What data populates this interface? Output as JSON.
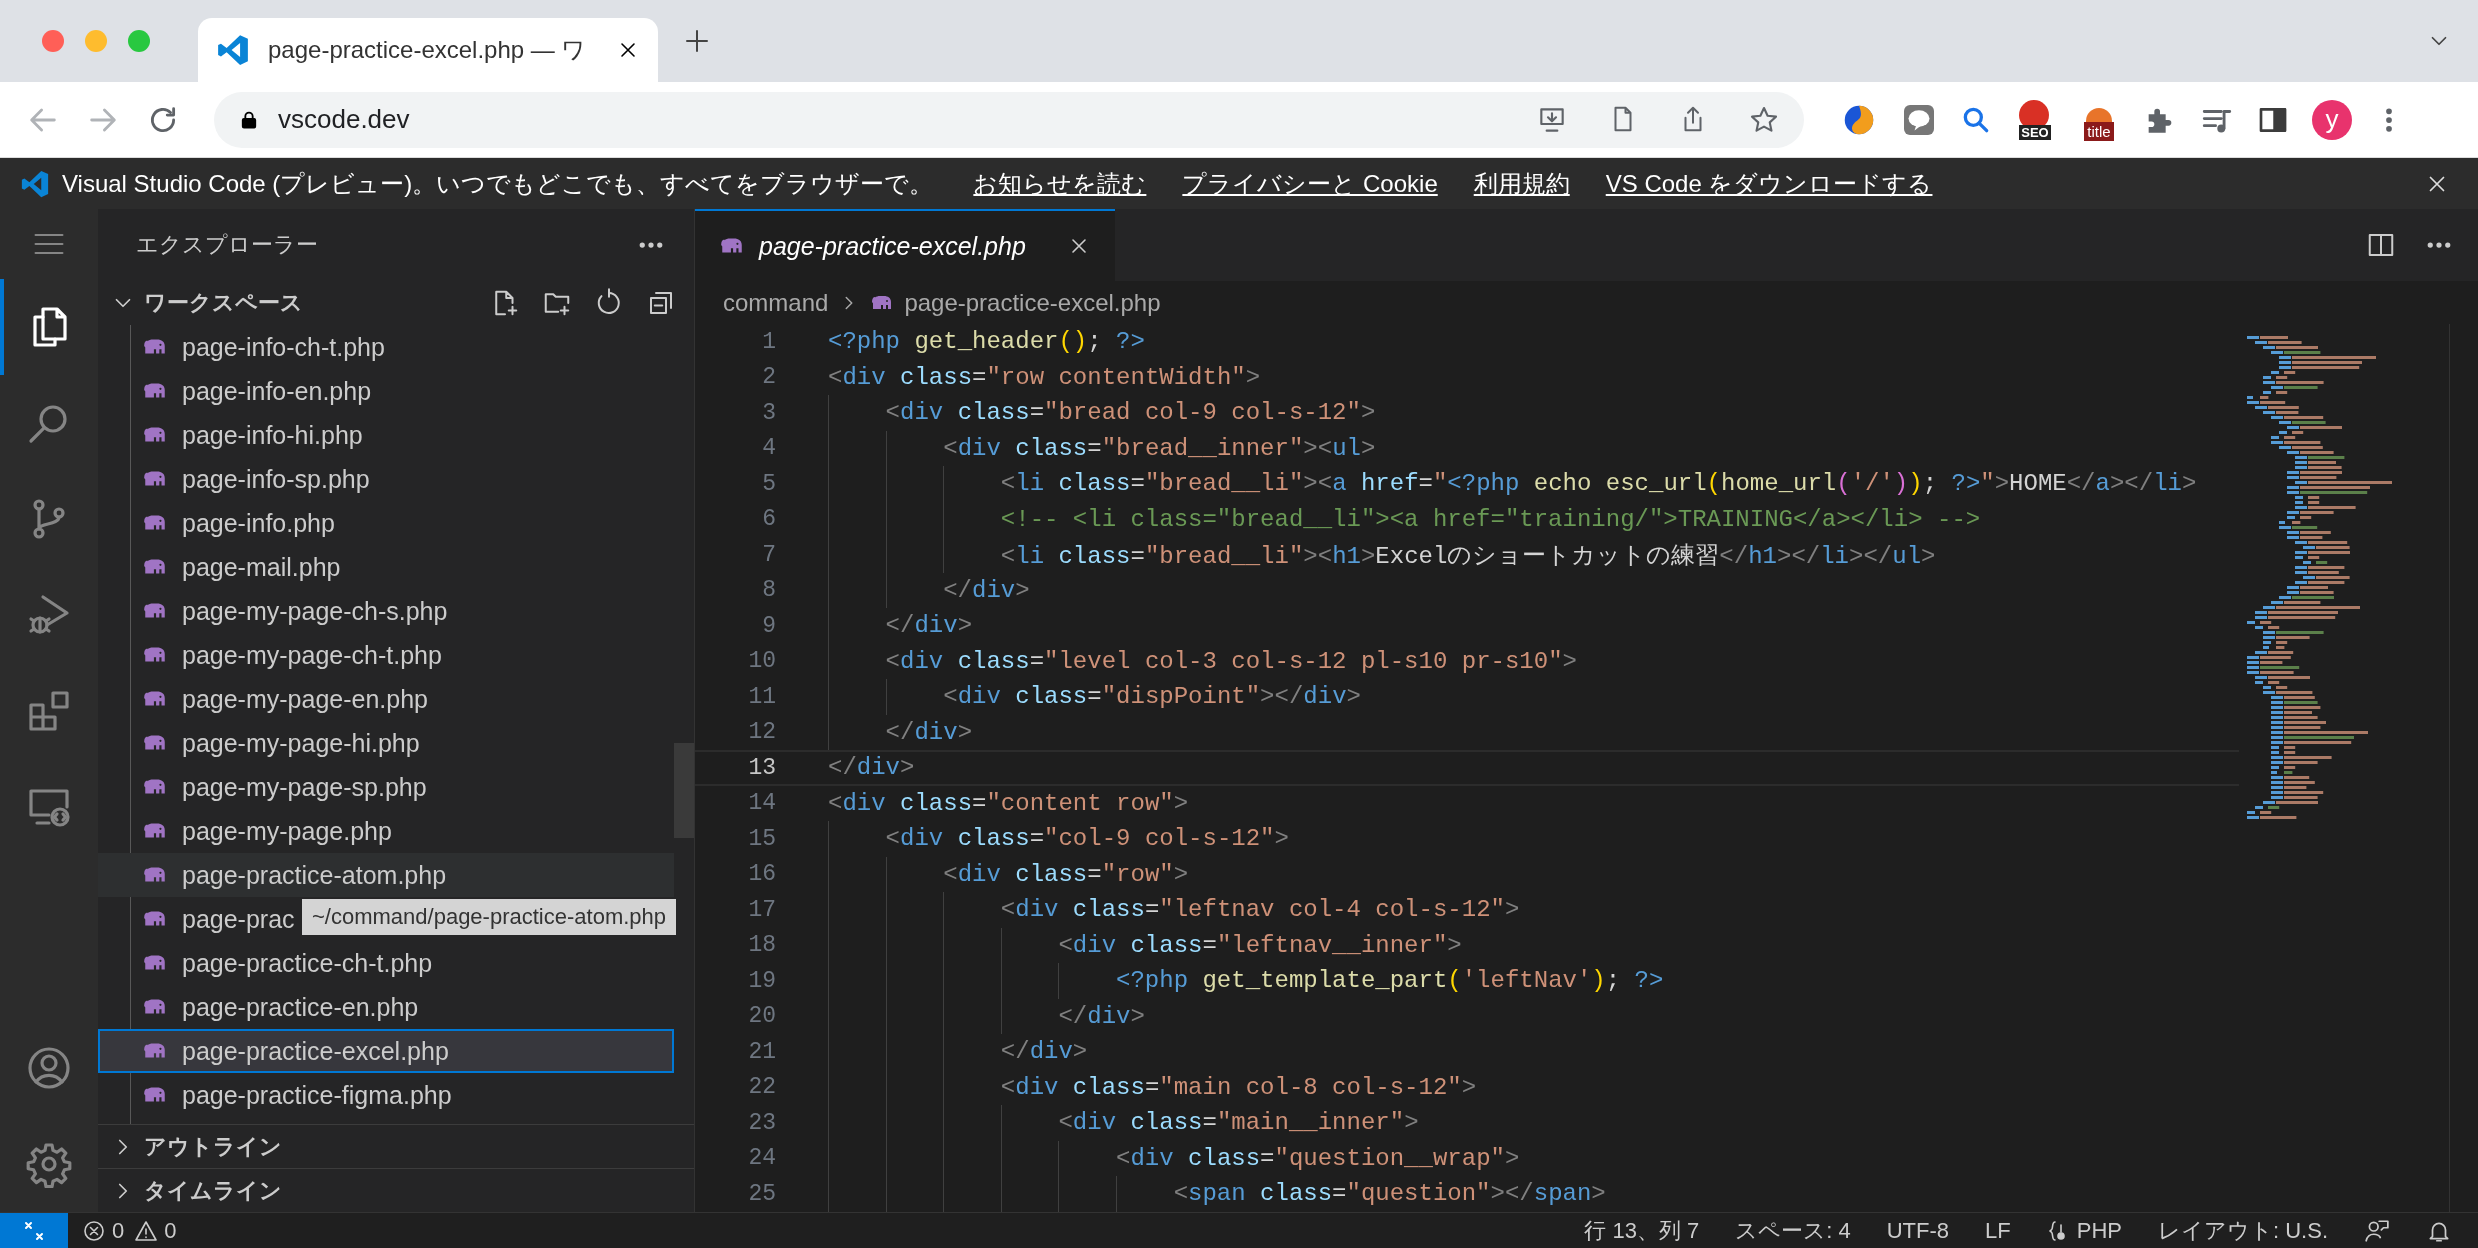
{
  "browser": {
    "tab": {
      "title": "page-practice-excel.php — ワ"
    },
    "address": "vscode.dev",
    "extensions": [
      {
        "kind": "swirl"
      },
      {
        "kind": "chat"
      },
      {
        "kind": "search"
      },
      {
        "kind": "seo",
        "label": "SEO"
      },
      {
        "kind": "title",
        "label": "title"
      },
      {
        "kind": "puzzle"
      },
      {
        "kind": "playlist"
      },
      {
        "kind": "sidepanel"
      }
    ],
    "avatar": "y"
  },
  "banner": {
    "text": "Visual Studio Code (プレビュー)。いつでもどこでも、すべてをブラウザーで。",
    "links": [
      "お知らせを読む",
      "プライバシーと Cookie",
      "利用規約",
      "VS Code をダウンロードする"
    ]
  },
  "activity_bar": [
    {
      "selected": true
    },
    {
      "selected": false
    },
    {
      "selected": false
    },
    {
      "selected": false
    },
    {
      "selected": false
    },
    {
      "selected": false
    }
  ],
  "sidebar": {
    "title": "エクスプローラー",
    "sections": [
      {
        "title": "ワークスペース",
        "expanded": true,
        "files": [
          {
            "name": "page-info-ch-t.php",
            "selected": false,
            "hovered": false
          },
          {
            "name": "page-info-en.php",
            "selected": false,
            "hovered": false
          },
          {
            "name": "page-info-hi.php",
            "selected": false,
            "hovered": false
          },
          {
            "name": "page-info-sp.php",
            "selected": false,
            "hovered": false
          },
          {
            "name": "page-info.php",
            "selected": false,
            "hovered": false
          },
          {
            "name": "page-mail.php",
            "selected": false,
            "hovered": false
          },
          {
            "name": "page-my-page-ch-s.php",
            "selected": false,
            "hovered": false
          },
          {
            "name": "page-my-page-ch-t.php",
            "selected": false,
            "hovered": false
          },
          {
            "name": "page-my-page-en.php",
            "selected": false,
            "hovered": false
          },
          {
            "name": "page-my-page-hi.php",
            "selected": false,
            "hovered": false
          },
          {
            "name": "page-my-page-sp.php",
            "selected": false,
            "hovered": false
          },
          {
            "name": "page-my-page.php",
            "selected": false,
            "hovered": false
          },
          {
            "name": "page-practice-atom.php",
            "selected": false,
            "hovered": true,
            "tooltip": "~/command/page-practice-atom.php"
          },
          {
            "name": "page-prac",
            "selected": false,
            "hovered": false
          },
          {
            "name": "page-practice-ch-t.php",
            "selected": false,
            "hovered": false
          },
          {
            "name": "page-practice-en.php",
            "selected": false,
            "hovered": false
          },
          {
            "name": "page-practice-excel.php",
            "selected": true,
            "hovered": false
          },
          {
            "name": "page-practice-figma.php",
            "selected": false,
            "hovered": false
          }
        ]
      },
      {
        "title": "アウトライン",
        "expanded": false
      },
      {
        "title": "タイムライン",
        "expanded": false
      }
    ]
  },
  "editor": {
    "tabs": [
      {
        "title": "page-practice-excel.php",
        "selected": true,
        "preview": true
      }
    ],
    "breadcrumb": [
      "command",
      "page-practice-excel.php"
    ],
    "lines": [
      {
        "number": "1",
        "current": false,
        "segments": [
          {
            "kind": "tag",
            "text": "<?php"
          },
          {
            "kind": "func",
            "text": " get_header"
          },
          {
            "kind": "bracket",
            "text": "()"
          },
          {
            "kind": "text",
            "text": "; "
          },
          {
            "kind": "tag",
            "text": "?>"
          }
        ]
      },
      {
        "number": "2",
        "current": false,
        "segments": [
          {
            "kind": "punct",
            "text": "<"
          },
          {
            "kind": "tag",
            "text": "div"
          },
          {
            "kind": "attr",
            "text": " class"
          },
          {
            "kind": "text",
            "text": "="
          },
          {
            "kind": "string",
            "text": "\"row contentWidth\""
          },
          {
            "kind": "punct",
            "text": ">"
          }
        ]
      },
      {
        "number": "3",
        "current": false,
        "segments": [
          {
            "kind": "punct",
            "text": "    <"
          },
          {
            "kind": "tag",
            "text": "div"
          },
          {
            "kind": "attr",
            "text": " class"
          },
          {
            "kind": "text",
            "text": "="
          },
          {
            "kind": "string",
            "text": "\"bread col-9 col-s-12\""
          },
          {
            "kind": "punct",
            "text": ">"
          }
        ]
      },
      {
        "number": "4",
        "current": false,
        "segments": [
          {
            "kind": "punct",
            "text": "        <"
          },
          {
            "kind": "tag",
            "text": "div"
          },
          {
            "kind": "attr",
            "text": " class"
          },
          {
            "kind": "text",
            "text": "="
          },
          {
            "kind": "string",
            "text": "\"bread__inner\""
          },
          {
            "kind": "punct",
            "text": "><"
          },
          {
            "kind": "tag",
            "text": "ul"
          },
          {
            "kind": "punct",
            "text": ">"
          }
        ]
      },
      {
        "number": "5",
        "current": false,
        "segments": [
          {
            "kind": "punct",
            "text": "            <"
          },
          {
            "kind": "tag",
            "text": "li"
          },
          {
            "kind": "attr",
            "text": " class"
          },
          {
            "kind": "text",
            "text": "="
          },
          {
            "kind": "string",
            "text": "\"bread__li\""
          },
          {
            "kind": "punct",
            "text": "><"
          },
          {
            "kind": "tag",
            "text": "a"
          },
          {
            "kind": "attr",
            "text": " href"
          },
          {
            "kind": "text",
            "text": "="
          },
          {
            "kind": "string",
            "text": "\""
          },
          {
            "kind": "tag",
            "text": "<?php"
          },
          {
            "kind": "func",
            "text": " echo esc_url"
          },
          {
            "kind": "bracket",
            "text": "("
          },
          {
            "kind": "func",
            "text": "home_url"
          },
          {
            "kind": "bracket2",
            "text": "("
          },
          {
            "kind": "string",
            "text": "'/'"
          },
          {
            "kind": "bracket2",
            "text": ")"
          },
          {
            "kind": "bracket",
            "text": ")"
          },
          {
            "kind": "text",
            "text": "; "
          },
          {
            "kind": "tag",
            "text": "?>"
          },
          {
            "kind": "string",
            "text": "\""
          },
          {
            "kind": "punct",
            "text": ">"
          },
          {
            "kind": "text",
            "text": "HOME"
          },
          {
            "kind": "punct",
            "text": "</"
          },
          {
            "kind": "tag",
            "text": "a"
          },
          {
            "kind": "punct",
            "text": "></"
          },
          {
            "kind": "tag",
            "text": "li"
          },
          {
            "kind": "punct",
            "text": ">"
          }
        ]
      },
      {
        "number": "6",
        "current": false,
        "segments": [
          {
            "kind": "comment",
            "text": "            <!-- <li class=\"bread__li\"><a href=\"training/\">TRAINING</a></li> -->"
          }
        ]
      },
      {
        "number": "7",
        "current": false,
        "segments": [
          {
            "kind": "punct",
            "text": "            <"
          },
          {
            "kind": "tag",
            "text": "li"
          },
          {
            "kind": "attr",
            "text": " class"
          },
          {
            "kind": "text",
            "text": "="
          },
          {
            "kind": "string",
            "text": "\"bread__li\""
          },
          {
            "kind": "punct",
            "text": "><"
          },
          {
            "kind": "tag",
            "text": "h1"
          },
          {
            "kind": "punct",
            "text": ">"
          },
          {
            "kind": "text",
            "text": "Excelのショートカットの練習"
          },
          {
            "kind": "punct",
            "text": "</"
          },
          {
            "kind": "tag",
            "text": "h1"
          },
          {
            "kind": "punct",
            "text": "></"
          },
          {
            "kind": "tag",
            "text": "li"
          },
          {
            "kind": "punct",
            "text": "></"
          },
          {
            "kind": "tag",
            "text": "ul"
          },
          {
            "kind": "punct",
            "text": ">"
          }
        ]
      },
      {
        "number": "8",
        "current": false,
        "segments": [
          {
            "kind": "punct",
            "text": "        </"
          },
          {
            "kind": "tag",
            "text": "div"
          },
          {
            "kind": "punct",
            "text": ">"
          }
        ]
      },
      {
        "number": "9",
        "current": false,
        "segments": [
          {
            "kind": "punct",
            "text": "    </"
          },
          {
            "kind": "tag",
            "text": "div"
          },
          {
            "kind": "punct",
            "text": ">"
          }
        ]
      },
      {
        "number": "10",
        "current": false,
        "segments": [
          {
            "kind": "punct",
            "text": "    <"
          },
          {
            "kind": "tag",
            "text": "div"
          },
          {
            "kind": "attr",
            "text": " class"
          },
          {
            "kind": "text",
            "text": "="
          },
          {
            "kind": "string",
            "text": "\"level col-3 col-s-12 pl-s10 pr-s10\""
          },
          {
            "kind": "punct",
            "text": ">"
          }
        ]
      },
      {
        "number": "11",
        "current": false,
        "segments": [
          {
            "kind": "punct",
            "text": "        <"
          },
          {
            "kind": "tag",
            "text": "div"
          },
          {
            "kind": "attr",
            "text": " class"
          },
          {
            "kind": "text",
            "text": "="
          },
          {
            "kind": "string",
            "text": "\"dispPoint\""
          },
          {
            "kind": "punct",
            "text": "></"
          },
          {
            "kind": "tag",
            "text": "div"
          },
          {
            "kind": "punct",
            "text": ">"
          }
        ]
      },
      {
        "number": "12",
        "current": false,
        "segments": [
          {
            "kind": "punct",
            "text": "    </"
          },
          {
            "kind": "tag",
            "text": "div"
          },
          {
            "kind": "punct",
            "text": ">"
          }
        ]
      },
      {
        "number": "13",
        "current": true,
        "segments": [
          {
            "kind": "punct",
            "text": "</"
          },
          {
            "kind": "tag",
            "text": "div"
          },
          {
            "kind": "punct",
            "text": ">"
          }
        ]
      },
      {
        "number": "14",
        "current": false,
        "segments": [
          {
            "kind": "punct",
            "text": "<"
          },
          {
            "kind": "tag",
            "text": "div"
          },
          {
            "kind": "attr",
            "text": " class"
          },
          {
            "kind": "text",
            "text": "="
          },
          {
            "kind": "string",
            "text": "\"content row\""
          },
          {
            "kind": "punct",
            "text": ">"
          }
        ]
      },
      {
        "number": "15",
        "current": false,
        "segments": [
          {
            "kind": "punct",
            "text": "    <"
          },
          {
            "kind": "tag",
            "text": "div"
          },
          {
            "kind": "attr",
            "text": " class"
          },
          {
            "kind": "text",
            "text": "="
          },
          {
            "kind": "string",
            "text": "\"col-9 col-s-12\""
          },
          {
            "kind": "punct",
            "text": ">"
          }
        ]
      },
      {
        "number": "16",
        "current": false,
        "segments": [
          {
            "kind": "punct",
            "text": "        <"
          },
          {
            "kind": "tag",
            "text": "div"
          },
          {
            "kind": "attr",
            "text": " class"
          },
          {
            "kind": "text",
            "text": "="
          },
          {
            "kind": "string",
            "text": "\"row\""
          },
          {
            "kind": "punct",
            "text": ">"
          }
        ]
      },
      {
        "number": "17",
        "current": false,
        "segments": [
          {
            "kind": "punct",
            "text": "            <"
          },
          {
            "kind": "tag",
            "text": "div"
          },
          {
            "kind": "attr",
            "text": " class"
          },
          {
            "kind": "text",
            "text": "="
          },
          {
            "kind": "string",
            "text": "\"leftnav col-4 col-s-12\""
          },
          {
            "kind": "punct",
            "text": ">"
          }
        ]
      },
      {
        "number": "18",
        "current": false,
        "segments": [
          {
            "kind": "punct",
            "text": "                <"
          },
          {
            "kind": "tag",
            "text": "div"
          },
          {
            "kind": "attr",
            "text": " class"
          },
          {
            "kind": "text",
            "text": "="
          },
          {
            "kind": "string",
            "text": "\"leftnav__inner\""
          },
          {
            "kind": "punct",
            "text": ">"
          }
        ]
      },
      {
        "number": "19",
        "current": false,
        "segments": [
          {
            "kind": "tag",
            "text": "                    <?php"
          },
          {
            "kind": "func",
            "text": " get_template_part"
          },
          {
            "kind": "bracket",
            "text": "("
          },
          {
            "kind": "string",
            "text": "'leftNav'"
          },
          {
            "kind": "bracket",
            "text": ")"
          },
          {
            "kind": "text",
            "text": "; "
          },
          {
            "kind": "tag",
            "text": "?>"
          }
        ]
      },
      {
        "number": "20",
        "current": false,
        "segments": [
          {
            "kind": "punct",
            "text": "                </"
          },
          {
            "kind": "tag",
            "text": "div"
          },
          {
            "kind": "punct",
            "text": ">"
          }
        ]
      },
      {
        "number": "21",
        "current": false,
        "segments": [
          {
            "kind": "punct",
            "text": "            </"
          },
          {
            "kind": "tag",
            "text": "div"
          },
          {
            "kind": "punct",
            "text": ">"
          }
        ]
      },
      {
        "number": "22",
        "current": false,
        "segments": [
          {
            "kind": "punct",
            "text": "            <"
          },
          {
            "kind": "tag",
            "text": "div"
          },
          {
            "kind": "attr",
            "text": " class"
          },
          {
            "kind": "text",
            "text": "="
          },
          {
            "kind": "string",
            "text": "\"main col-8 col-s-12\""
          },
          {
            "kind": "punct",
            "text": ">"
          }
        ]
      },
      {
        "number": "23",
        "current": false,
        "segments": [
          {
            "kind": "punct",
            "text": "                <"
          },
          {
            "kind": "tag",
            "text": "div"
          },
          {
            "kind": "attr",
            "text": " class"
          },
          {
            "kind": "text",
            "text": "="
          },
          {
            "kind": "string",
            "text": "\"main__inner\""
          },
          {
            "kind": "punct",
            "text": ">"
          }
        ]
      },
      {
        "number": "24",
        "current": false,
        "segments": [
          {
            "kind": "punct",
            "text": "                    <"
          },
          {
            "kind": "tag",
            "text": "div"
          },
          {
            "kind": "attr",
            "text": " class"
          },
          {
            "kind": "text",
            "text": "="
          },
          {
            "kind": "string",
            "text": "\"question__wrap\""
          },
          {
            "kind": "punct",
            "text": ">"
          }
        ]
      },
      {
        "number": "25",
        "current": false,
        "segments": [
          {
            "kind": "punct",
            "text": "                        <"
          },
          {
            "kind": "tag",
            "text": "span"
          },
          {
            "kind": "attr",
            "text": " class"
          },
          {
            "kind": "text",
            "text": "="
          },
          {
            "kind": "string",
            "text": "\"question\""
          },
          {
            "kind": "punct",
            "text": "></"
          },
          {
            "kind": "tag",
            "text": "span"
          },
          {
            "kind": "punct",
            "text": ">"
          }
        ]
      }
    ]
  },
  "status_bar": {
    "errors": "0",
    "warnings": "0",
    "items": [
      "行 13、列 7",
      "スペース: 4",
      "UTF-8",
      "LF"
    ],
    "language": "PHP",
    "layout": "レイアウト: U.S."
  }
}
